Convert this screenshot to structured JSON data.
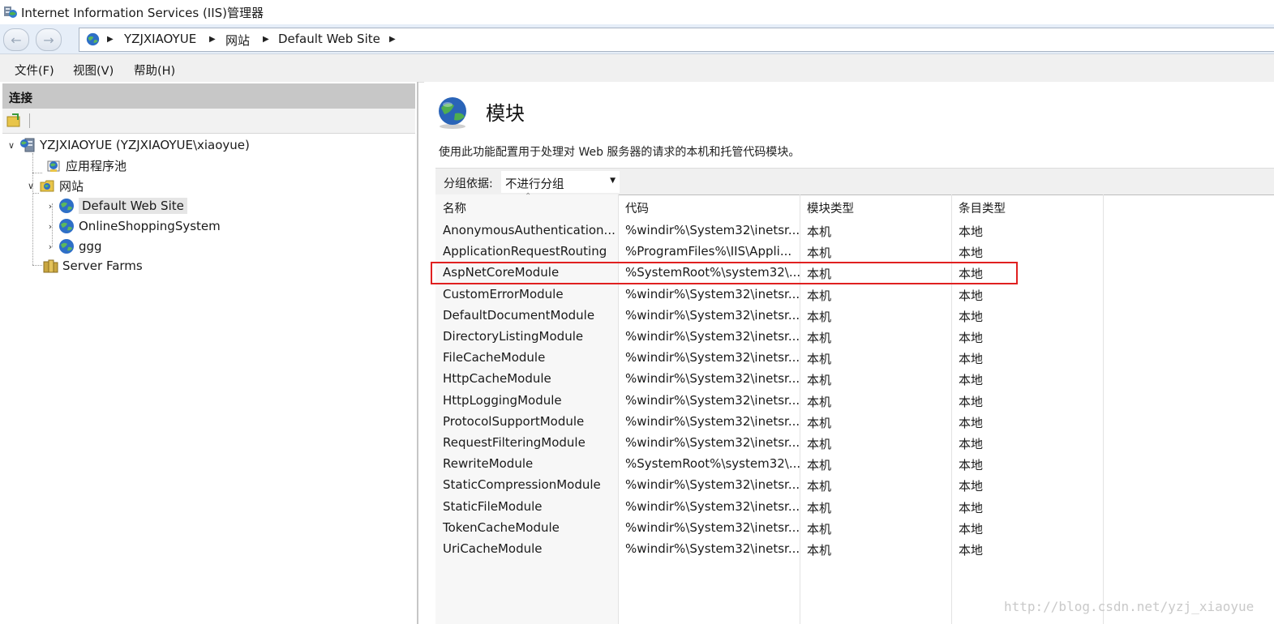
{
  "window": {
    "title": "Internet Information Services (IIS)管理器"
  },
  "address": {
    "crumbs": [
      "YZJXIAOYUE",
      "网站",
      "Default Web Site"
    ]
  },
  "menu": [
    "文件(F)",
    "视图(V)",
    "帮助(H)"
  ],
  "connections": {
    "header": "连接",
    "tree": {
      "server": "YZJXIAOYUE (YZJXIAOYUE\\xiaoyue)",
      "app_pools": "应用程序池",
      "sites": "网站",
      "site_items": [
        "Default Web Site",
        "OnlineShoppingSystem",
        "ggg"
      ],
      "server_farms": "Server Farms"
    }
  },
  "feature": {
    "title": "模块",
    "description": "使用此功能配置用于处理对 Web 服务器的请求的本机和托管代码模块。",
    "group_by_label": "分组依据:",
    "group_by_value": "不进行分组"
  },
  "table": {
    "columns": [
      "名称",
      "代码",
      "模块类型",
      "条目类型"
    ],
    "rows": [
      [
        "AnonymousAuthentication...",
        "%windir%\\System32\\inetsr...",
        "本机",
        "本地"
      ],
      [
        "ApplicationRequestRouting",
        "%ProgramFiles%\\IIS\\Appli...",
        "本机",
        "本地"
      ],
      [
        "AspNetCoreModule",
        "%SystemRoot%\\system32\\...",
        "本机",
        "本地"
      ],
      [
        "CustomErrorModule",
        "%windir%\\System32\\inetsr...",
        "本机",
        "本地"
      ],
      [
        "DefaultDocumentModule",
        "%windir%\\System32\\inetsr...",
        "本机",
        "本地"
      ],
      [
        "DirectoryListingModule",
        "%windir%\\System32\\inetsr...",
        "本机",
        "本地"
      ],
      [
        "FileCacheModule",
        "%windir%\\System32\\inetsr...",
        "本机",
        "本地"
      ],
      [
        "HttpCacheModule",
        "%windir%\\System32\\inetsr...",
        "本机",
        "本地"
      ],
      [
        "HttpLoggingModule",
        "%windir%\\System32\\inetsr...",
        "本机",
        "本地"
      ],
      [
        "ProtocolSupportModule",
        "%windir%\\System32\\inetsr...",
        "本机",
        "本地"
      ],
      [
        "RequestFilteringModule",
        "%windir%\\System32\\inetsr...",
        "本机",
        "本地"
      ],
      [
        "RewriteModule",
        "%SystemRoot%\\system32\\...",
        "本机",
        "本地"
      ],
      [
        "StaticCompressionModule",
        "%windir%\\System32\\inetsr...",
        "本机",
        "本地"
      ],
      [
        "StaticFileModule",
        "%windir%\\System32\\inetsr...",
        "本机",
        "本地"
      ],
      [
        "TokenCacheModule",
        "%windir%\\System32\\inetsr...",
        "本机",
        "本地"
      ],
      [
        "UriCacheModule",
        "%windir%\\System32\\inetsr...",
        "本机",
        "本地"
      ]
    ],
    "highlighted_row": "AspNetCoreModule"
  },
  "watermark": "http://blog.csdn.net/yzj_xiaoyue",
  "colors": {
    "highlight": "#e02020",
    "selection": "#e5e5e5",
    "header_gray": "#c7c7c7"
  }
}
